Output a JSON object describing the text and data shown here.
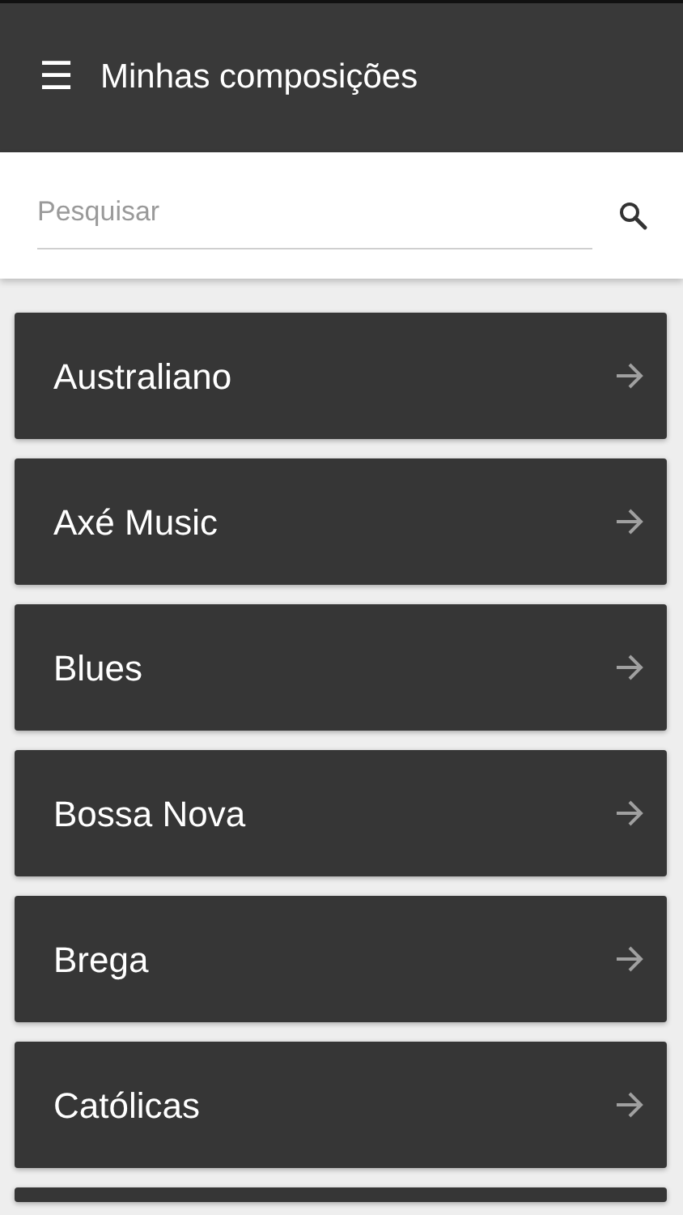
{
  "app_bar": {
    "menu_icon": "☰",
    "title": "Minhas composições"
  },
  "search": {
    "placeholder": "Pesquisar"
  },
  "items": [
    {
      "label": "Australiano"
    },
    {
      "label": "Axé Music"
    },
    {
      "label": "Blues"
    },
    {
      "label": "Bossa Nova"
    },
    {
      "label": "Brega"
    },
    {
      "label": "Católicas"
    }
  ]
}
